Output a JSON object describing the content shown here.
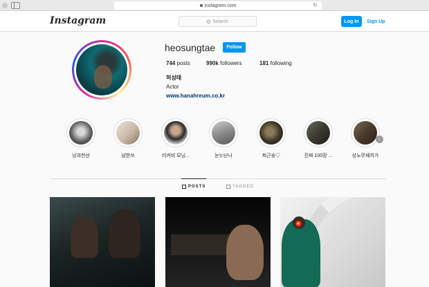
{
  "browser": {
    "url": "instagram.com"
  },
  "header": {
    "logo": "Instagram",
    "search_placeholder": "Search",
    "login_label": "Log In",
    "signup_label": "Sign Up"
  },
  "profile": {
    "username": "heosungtae",
    "follow_label": "Follow",
    "posts_count": "744",
    "posts_label": "posts",
    "followers_count": "990k",
    "followers_label": "followers",
    "following_count": "181",
    "following_label": "following",
    "name": "허성태",
    "bio": "Actor",
    "website": "www.hanahreum.co.kr"
  },
  "highlights": [
    {
      "label": "낭과천선"
    },
    {
      "label": "남한쓰"
    },
    {
      "label": "러커비 모닝..."
    },
    {
      "label": "눈누난나"
    },
    {
      "label": "퇴근송♡"
    },
    {
      "label": "진짜 100장 ..."
    },
    {
      "label": "상노무쉐끼가"
    }
  ],
  "tabs": {
    "posts_label": "POSTS",
    "tagged_label": "TAGGED"
  },
  "colors": {
    "accent": "#0095f6",
    "link": "#00376b",
    "divider": "#dbdbdb"
  }
}
